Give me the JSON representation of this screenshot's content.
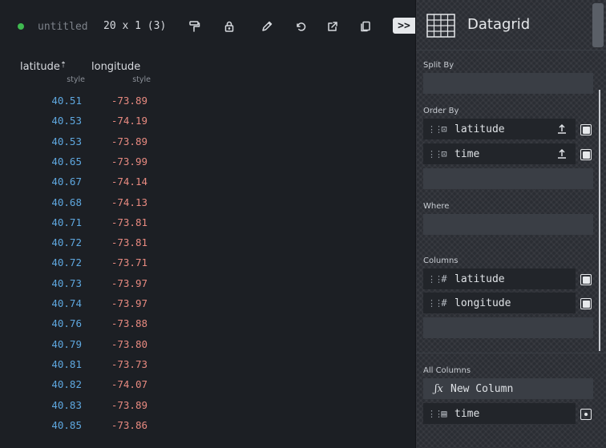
{
  "toolbar": {
    "status_color": "#3fb950",
    "title": "untitled",
    "dimensions": "20 x 1 (3)",
    "collapse_label": ">>",
    "icons": [
      "paint-roller-icon",
      "lock-icon",
      "pencil-icon",
      "undo-icon",
      "export-icon",
      "copy-icon"
    ]
  },
  "grid": {
    "columns": [
      {
        "name": "latitude",
        "sub": "style",
        "sort_indicator": "sort-ascending-icon"
      },
      {
        "name": "longitude",
        "sub": "style"
      }
    ],
    "rows": [
      [
        "40.51",
        "-73.89"
      ],
      [
        "40.53",
        "-74.19"
      ],
      [
        "40.53",
        "-73.89"
      ],
      [
        "40.65",
        "-73.99"
      ],
      [
        "40.67",
        "-74.14"
      ],
      [
        "40.68",
        "-74.13"
      ],
      [
        "40.71",
        "-73.81"
      ],
      [
        "40.72",
        "-73.81"
      ],
      [
        "40.72",
        "-73.71"
      ],
      [
        "40.73",
        "-73.97"
      ],
      [
        "40.74",
        "-73.97"
      ],
      [
        "40.76",
        "-73.88"
      ],
      [
        "40.79",
        "-73.80"
      ],
      [
        "40.81",
        "-73.73"
      ],
      [
        "40.82",
        "-74.07"
      ],
      [
        "40.83",
        "-73.89"
      ],
      [
        "40.85",
        "-73.86"
      ]
    ],
    "colors": {
      "latitude": "#5fa8e0",
      "longitude": "#e88a80"
    }
  },
  "panel": {
    "plugin_name": "Datagrid",
    "split_by_label": "Split By",
    "order_by_label": "Order By",
    "order_by": [
      {
        "name": "latitude",
        "type_icon": "string-type-icon",
        "sort_icon": "sort-ascending-icon"
      },
      {
        "name": "time",
        "type_icon": "string-type-icon",
        "sort_icon": "sort-ascending-icon"
      }
    ],
    "where_label": "Where",
    "columns_label": "Columns",
    "columns": [
      {
        "name": "latitude",
        "type_glyph": "#"
      },
      {
        "name": "longitude",
        "type_glyph": "#"
      }
    ],
    "all_columns_label": "All Columns",
    "new_column_label": "New Column",
    "all_columns": [
      {
        "name": "time",
        "type_icon": "calendar-icon"
      }
    ]
  }
}
